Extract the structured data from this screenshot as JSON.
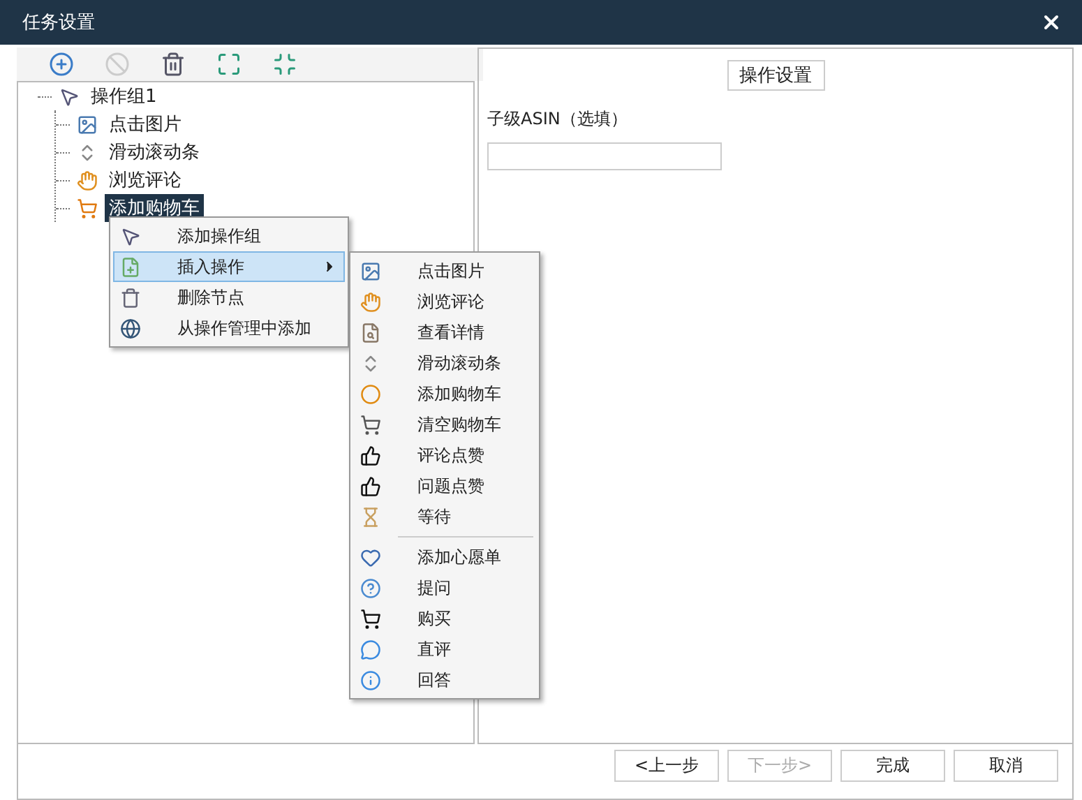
{
  "window": {
    "title": "任务设置"
  },
  "toolbar": [
    {
      "disabled": false
    },
    {
      "disabled": true
    },
    {
      "disabled": false
    },
    {
      "disabled": false
    },
    {
      "disabled": false
    }
  ],
  "tree": {
    "label": "操作组1",
    "selected": false,
    "children": [
      {
        "label": "点击图片",
        "selected": false
      },
      {
        "label": "滑动滚动条",
        "selected": false
      },
      {
        "label": "浏览评论",
        "selected": false
      },
      {
        "label": "添加购物车",
        "selected": true
      }
    ]
  },
  "context_menu": {
    "items": [
      {
        "label": "添加操作组",
        "highlighted": false,
        "has_submenu": false
      },
      {
        "label": "插入操作",
        "highlighted": true,
        "has_submenu": true
      },
      {
        "label": "删除节点",
        "highlighted": false,
        "has_submenu": false
      },
      {
        "label": "从操作管理中添加",
        "highlighted": false,
        "has_submenu": false
      }
    ]
  },
  "submenu": {
    "groups": [
      [
        "点击图片",
        "浏览评论",
        "查看详情",
        "滑动滚动条",
        "添加购物车",
        "清空购物车",
        "评论点赞",
        "问题点赞",
        "等待"
      ],
      [
        "添加心愿单",
        "提问",
        "购买",
        "直评",
        "回答"
      ]
    ]
  },
  "settings": {
    "legend": "操作设置",
    "field": {
      "label": "子级ASIN（选填）"
    }
  },
  "buttons": [
    {
      "label": "<上一步",
      "disabled": false
    },
    {
      "label": "下一步>",
      "disabled": true
    },
    {
      "label": "完成",
      "disabled": false
    },
    {
      "label": "取消",
      "disabled": false
    }
  ]
}
